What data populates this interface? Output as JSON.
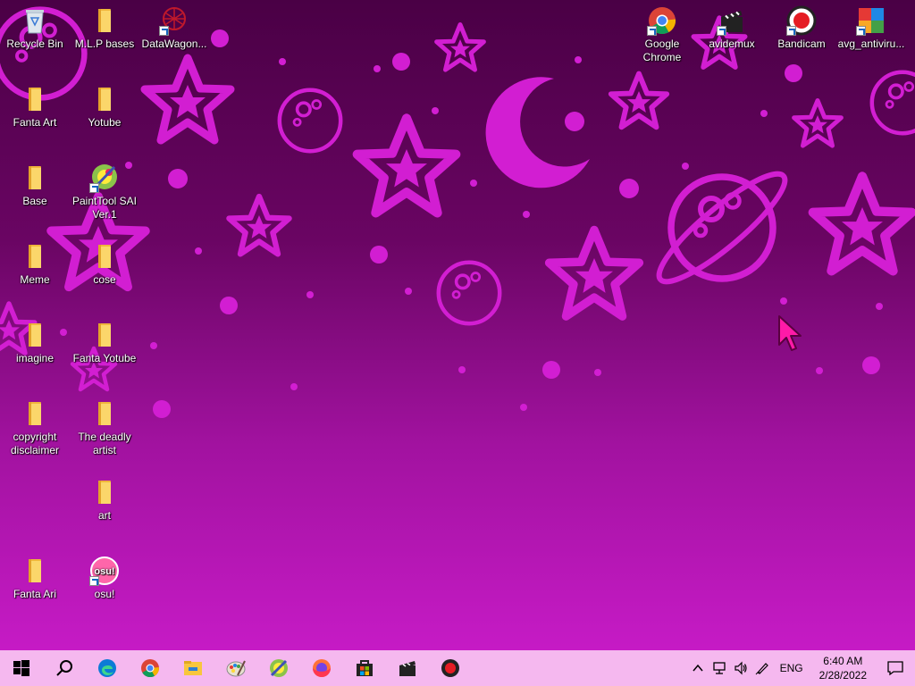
{
  "desktop": {
    "icons": [
      {
        "label": "Recycle Bin",
        "icon": "recycle-bin-icon"
      },
      {
        "label": "M.L.P bases",
        "icon": "folder-icon"
      },
      {
        "label": "DataWagon...",
        "icon": "datawagon-icon"
      },
      {
        "label": "Fanta Art",
        "icon": "folder-icon"
      },
      {
        "label": "Yotube",
        "icon": "folder-icon"
      },
      {
        "label": "Base",
        "icon": "folder-icon"
      },
      {
        "label": "PaintTool SAI Ver.1",
        "icon": "painttool-sai-icon"
      },
      {
        "label": "Meme",
        "icon": "folder-icon"
      },
      {
        "label": "cose",
        "icon": "folder-icon"
      },
      {
        "label": "imagine",
        "icon": "folder-icon"
      },
      {
        "label": "Fanta Yotube",
        "icon": "folder-icon"
      },
      {
        "label": "copyright disclaimer",
        "icon": "folder-icon"
      },
      {
        "label": "The deadly artist",
        "icon": "folder-icon"
      },
      {
        "label": "art",
        "icon": "folder-icon"
      },
      {
        "label": "Fanta Ari",
        "icon": "folder-icon"
      },
      {
        "label": "osu!",
        "icon": "osu-icon"
      },
      {
        "label": "Google Chrome",
        "icon": "chrome-icon"
      },
      {
        "label": "avidemux",
        "icon": "avidemux-icon"
      },
      {
        "label": "Bandicam",
        "icon": "bandicam-icon"
      },
      {
        "label": "avg_antiviru...",
        "icon": "avg-antivirus-icon"
      }
    ]
  },
  "taskbar": {
    "apps": [
      "start-icon",
      "search-icon",
      "edge-icon",
      "chrome-icon",
      "file-explorer-icon",
      "paint-icon",
      "painttool-sai-icon",
      "firefox-icon",
      "store-icon",
      "avidemux-icon",
      "bandicam-icon"
    ],
    "tray": {
      "language": "ENG",
      "time": "6:40 AM",
      "date": "2/28/2022"
    }
  },
  "colors": {
    "wallpaper_accent": "#d21ed2",
    "taskbar": "#f5b8ef",
    "cursor": "#ff1aa8"
  }
}
